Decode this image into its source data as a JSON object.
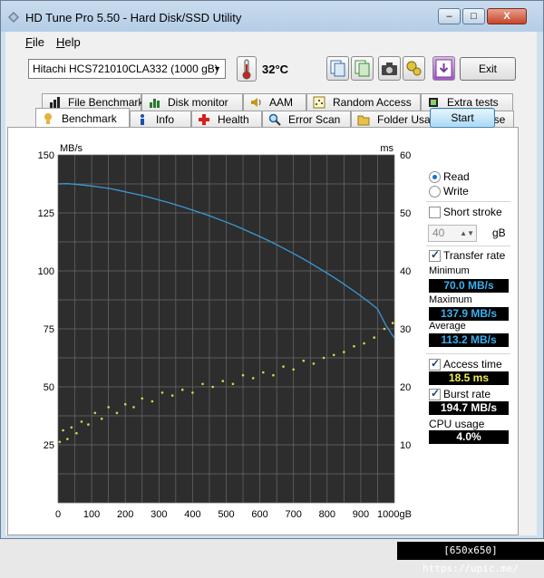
{
  "window": {
    "title": "HD Tune Pro 5.50 - Hard Disk/SSD Utility",
    "minimize": "–",
    "maximize": "□",
    "close": "X"
  },
  "menu": [
    {
      "key": "F",
      "rest": "ile"
    },
    {
      "key": "H",
      "rest": "elp"
    }
  ],
  "toolbar": {
    "drive": "Hitachi HCS721010CLA332 (1000 gB)",
    "temperature": "32°C",
    "exit_label": "Exit"
  },
  "tabs_top": [
    "File Benchmark",
    "Disk monitor",
    "AAM",
    "Random Access",
    "Extra tests"
  ],
  "tabs_bottom": [
    "Benchmark",
    "Info",
    "Health",
    "Error Scan",
    "Folder Usage",
    "Erase"
  ],
  "controls": {
    "start_label": "Start",
    "read_label": "Read",
    "write_label": "Write",
    "short_stroke_label": "Short stroke",
    "short_stroke_value": "40",
    "short_stroke_unit": "gB",
    "transfer_rate_label": "Transfer rate",
    "access_time_label": "Access time",
    "burst_rate_label": "Burst rate",
    "cpu_label": "CPU usage"
  },
  "stats": {
    "minimum_label": "Minimum",
    "minimum_value": "70.0 MB/s",
    "maximum_label": "Maximum",
    "maximum_value": "137.9 MB/s",
    "average_label": "Average",
    "average_value": "113.2 MB/s",
    "access_time_value": "18.5 ms",
    "burst_rate_value": "194.7 MB/s",
    "cpu_value": "4.0%"
  },
  "colors": {
    "transfer_line": "#3a9ad8",
    "access_points": "#d7d84a",
    "min_max_avg_text": "#3ab0f0",
    "access_text": "#f0f050",
    "burst_text": "#ffffff",
    "cpu_text": "#ffffff"
  },
  "chart_data": {
    "type": "line",
    "left_unit": "MB/s",
    "right_unit": "ms",
    "y_left_ticks": [
      "150",
      "125",
      "100",
      "75",
      "50",
      "25"
    ],
    "y_right_ticks": [
      "60",
      "50",
      "40",
      "30",
      "20",
      "10"
    ],
    "x_ticks": [
      "0",
      "100",
      "200",
      "300",
      "400",
      "500",
      "600",
      "700",
      "800",
      "900",
      "1000gB"
    ],
    "xlim": [
      0,
      1000
    ],
    "ylim_left": [
      0,
      150
    ],
    "ylim_right": [
      0,
      60
    ],
    "grid": true,
    "series": [
      {
        "name": "Transfer rate",
        "axis": "left",
        "x": [
          0,
          25,
          50,
          75,
          100,
          125,
          150,
          175,
          200,
          225,
          250,
          275,
          300,
          325,
          350,
          375,
          400,
          425,
          450,
          475,
          500,
          525,
          550,
          575,
          600,
          625,
          650,
          675,
          700,
          725,
          750,
          775,
          800,
          825,
          850,
          875,
          900,
          925,
          950,
          975,
          1000
        ],
        "y": [
          137.5,
          137.6,
          137.4,
          137.0,
          136.6,
          136.1,
          135.6,
          134.9,
          134.1,
          133.3,
          132.5,
          131.6,
          130.6,
          129.6,
          128.5,
          127.4,
          126.2,
          125.0,
          123.8,
          122.4,
          121.0,
          119.6,
          118.0,
          116.4,
          114.8,
          113.1,
          111.3,
          109.4,
          107.5,
          105.5,
          103.4,
          101.2,
          99.0,
          96.7,
          94.3,
          91.8,
          89.2,
          86.5,
          83.6,
          76.5,
          71.0
        ]
      },
      {
        "name": "Access time",
        "axis": "right",
        "x": [
          5,
          15,
          28,
          40,
          55,
          70,
          90,
          110,
          130,
          150,
          175,
          200,
          225,
          250,
          280,
          310,
          340,
          370,
          400,
          430,
          460,
          490,
          520,
          550,
          580,
          610,
          640,
          670,
          700,
          730,
          760,
          790,
          820,
          850,
          880,
          910,
          940,
          970,
          995
        ],
        "y": [
          10.5,
          12.5,
          11.0,
          13.0,
          12.0,
          14.0,
          13.5,
          15.5,
          14.5,
          16.5,
          15.5,
          17.0,
          16.5,
          18.0,
          17.5,
          19.0,
          18.5,
          19.5,
          19.0,
          20.5,
          20.0,
          21.0,
          20.5,
          22.0,
          21.5,
          22.5,
          22.0,
          23.5,
          23.0,
          24.5,
          24.0,
          25.0,
          25.5,
          26.0,
          27.0,
          27.5,
          28.5,
          30.0,
          31.0
        ]
      }
    ]
  },
  "watermark": "[650x650] https://upic.me/"
}
